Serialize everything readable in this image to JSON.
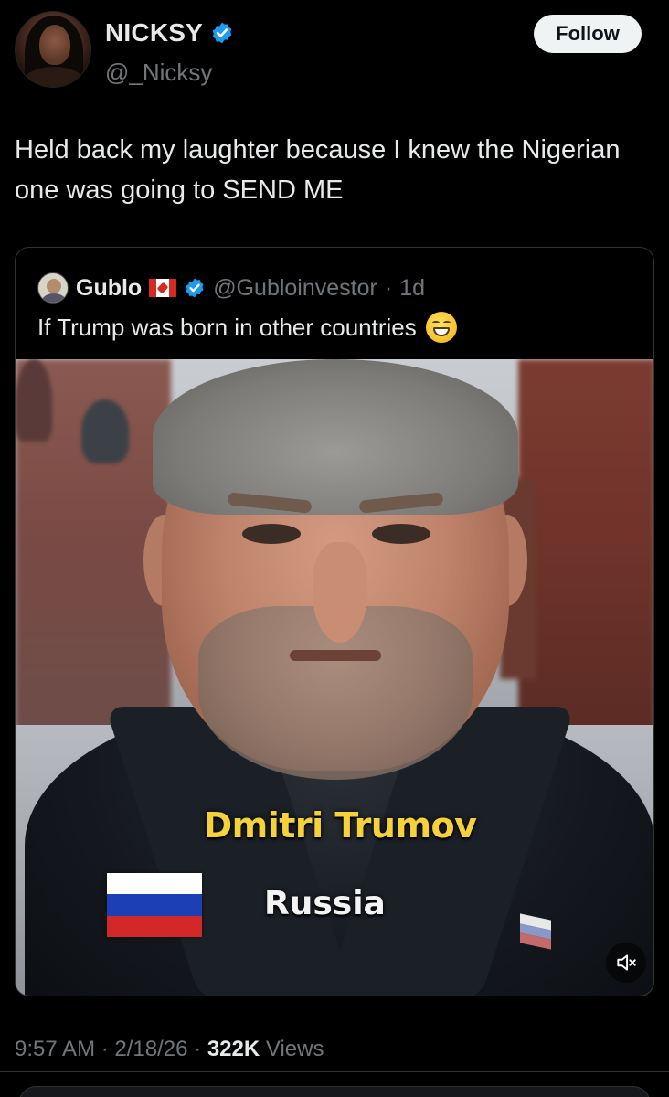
{
  "author": {
    "display_name": "NICKSY",
    "handle": "@_Nicksy",
    "verified": true
  },
  "follow_label": "Follow",
  "tweet_text": "Held back my laughter because I knew the Nigerian one was going to SEND ME",
  "quoted": {
    "display_name": "Gublo",
    "flag_icon": "canada-flag-icon",
    "verified": true,
    "handle": "@Gubloinvestor",
    "separator": "·",
    "age": "1d",
    "text": "If Trump was born in other countries",
    "emoji_icon": "grinning-face-icon",
    "media": {
      "caption_name": "Dmitri Trumov",
      "caption_country": "Russia",
      "flag_icon": "russia-flag-icon",
      "mute_icon": "speaker-muted-icon"
    }
  },
  "meta": {
    "time": "9:57 AM",
    "sep1": "·",
    "date": "2/18/26",
    "sep2": "·",
    "views_count": "322K",
    "views_label": "Views"
  },
  "colors": {
    "background": "#000000",
    "text": "#e7e9ea",
    "muted": "#71767b",
    "verified_blue": "#1d9bf0",
    "caption_yellow": "#f5d23a"
  }
}
